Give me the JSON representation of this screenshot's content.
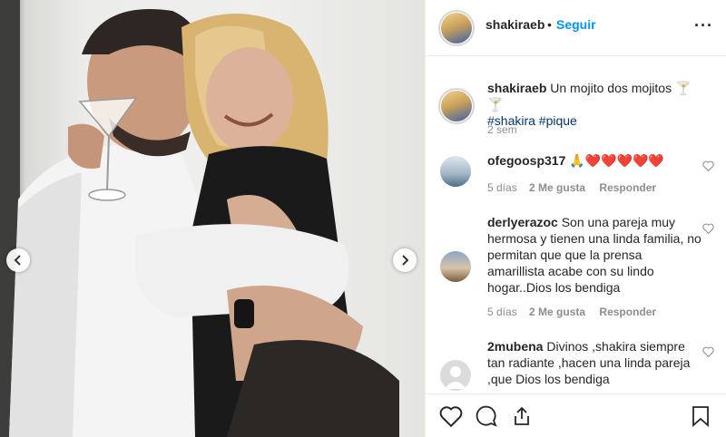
{
  "post": {
    "username": "shakiraeb",
    "dot": "•",
    "follow_label": "Seguir",
    "more_label": "···"
  },
  "caption": {
    "username": "shakiraeb",
    "text": "Un mojito dos mojitos",
    "emoji": "🍸🍸",
    "hashtags": "#shakira #pique",
    "time": "2 sem"
  },
  "comments": [
    {
      "username": "ofegoosp317",
      "text": "🙏❤️❤️❤️❤️❤️",
      "time": "5 días",
      "likes": "2 Me gusta",
      "reply": "Responder"
    },
    {
      "username": "derlyerazoc",
      "text": "Son una pareja muy hermosa y tienen una linda familia, no permitan que que la prensa amarillista acabe con su lindo hogar..Dios los bendiga",
      "time": "5 días",
      "likes": "2 Me gusta",
      "reply": "Responder"
    },
    {
      "username": "2mubena",
      "text": "Divinos ,shakira siempre tan radiante ,hacen una linda pareja ,que Dios los bendiga"
    }
  ],
  "icons": {
    "more": "more-options-icon",
    "like": "heart-icon",
    "comment": "comment-icon",
    "share": "share-icon",
    "save": "bookmark-icon",
    "prev": "chevron-left-icon",
    "next": "chevron-right-icon"
  },
  "colors": {
    "link_blue": "#0095f6",
    "hashtag": "#00376b",
    "muted": "#8e8e8e",
    "heart_red": "#ed4956"
  }
}
